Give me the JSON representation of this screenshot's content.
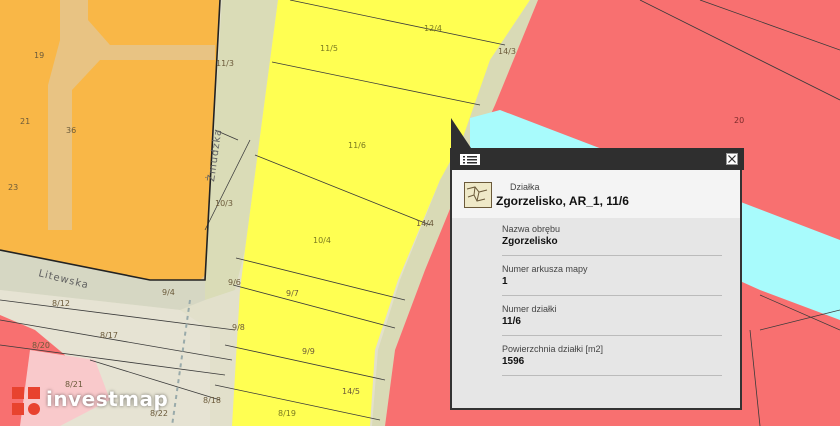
{
  "map": {
    "colors": {
      "orange": "#f9b747",
      "yellow": "#ffff52",
      "red": "#f87070",
      "cyan": "#a8fbfc",
      "pink": "#f9c9cb",
      "road": "#d9dab6",
      "road_light": "#e6e3d3",
      "tan": "#e5c48a"
    },
    "parcel_labels": {
      "p19": "19",
      "p21": "21",
      "p23": "23",
      "p36": "36",
      "p11_3": "11/3",
      "p10_3": "10/3",
      "p9_4": "9/4",
      "p9_6": "9/6",
      "p9_7": "9/7",
      "p9_8": "9/8",
      "p9_9": "9/9",
      "p8_12": "8/12",
      "p8_17": "8/17",
      "p8_20": "8/20",
      "p8_21": "8/21",
      "p8_22": "8/22",
      "p8_18": "8/18",
      "p8_19": "8/19",
      "p11_5": "11/5",
      "p11_6": "11/6",
      "p10_4": "10/4",
      "p12_4": "12/4",
      "p14_3": "14/3",
      "p14_4": "14/4",
      "p14_5": "14/5",
      "p20": "20"
    },
    "streets": {
      "zmudzka": "Żmudzka",
      "litewska": "Litewska"
    }
  },
  "popup": {
    "list_icon": "list-icon",
    "close_icon": "close-icon",
    "category": "Działka",
    "title": "Zgorzelisko, AR_1, 11/6",
    "fields": [
      {
        "label": "Nazwa obrębu",
        "value": "Zgorzelisko"
      },
      {
        "label": "Numer arkusza mapy",
        "value": "1"
      },
      {
        "label": "Numer działki",
        "value": "11/6"
      },
      {
        "label": "Powierzchnia działki [m2]",
        "value": "1596"
      }
    ]
  },
  "logo": {
    "text": "investmap",
    "mark_color": "#e8432f"
  }
}
